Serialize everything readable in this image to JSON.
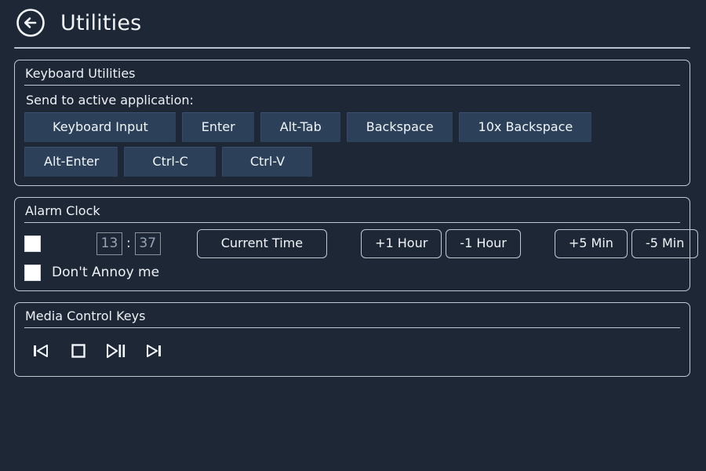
{
  "header": {
    "back_icon": "back-arrow-circle-icon",
    "title": "Utilities"
  },
  "keyboard_section": {
    "title": "Keyboard Utilities",
    "label": "Send to active application:",
    "buttons": [
      {
        "label": "Keyboard Input"
      },
      {
        "label": "Enter"
      },
      {
        "label": "Alt-Tab"
      },
      {
        "label": "Backspace"
      },
      {
        "label": "10x Backspace"
      },
      {
        "label": "Alt-Enter"
      },
      {
        "label": "Ctrl-C"
      },
      {
        "label": "Ctrl-V"
      }
    ]
  },
  "alarm_section": {
    "title": "Alarm Clock",
    "enabled": false,
    "hours": "13",
    "minutes": "37",
    "separator": ":",
    "current_time_label": "Current Time",
    "plus_hour_label": "+1 Hour",
    "minus_hour_label": "-1 Hour",
    "plus_min_label": "+5 Min",
    "minus_min_label": "-5 Min",
    "dont_annoy_label": "Don't Annoy me",
    "dont_annoy_checked": false
  },
  "media_section": {
    "title": "Media Control Keys",
    "buttons": [
      {
        "icon": "previous-track-icon"
      },
      {
        "icon": "stop-icon"
      },
      {
        "icon": "play-pause-icon"
      },
      {
        "icon": "next-track-icon"
      }
    ]
  },
  "colors": {
    "background": "#1d2736",
    "button_fill": "#2c4159",
    "border": "#c3c9d2",
    "text": "#eef2f7",
    "spin_text": "#97a3b4"
  }
}
